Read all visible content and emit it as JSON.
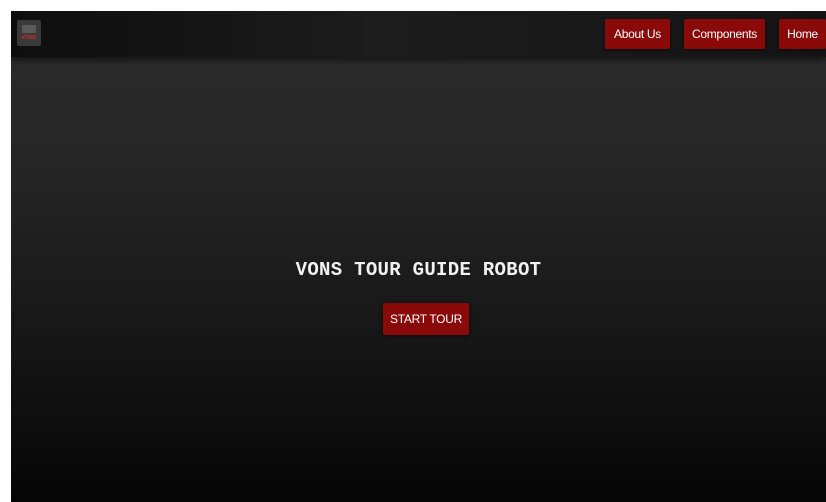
{
  "brand": {
    "logo_text": "VONS",
    "logo_text_color": "#d42a2a"
  },
  "nav": {
    "items": [
      {
        "label": "About Us"
      },
      {
        "label": "Components"
      },
      {
        "label": "Home"
      }
    ],
    "button_color": "#8a0a0a"
  },
  "hero": {
    "title": "VONS TOUR GUIDE ROBOT",
    "cta_label": "START TOUR",
    "cta_color": "#8a0a0a"
  }
}
